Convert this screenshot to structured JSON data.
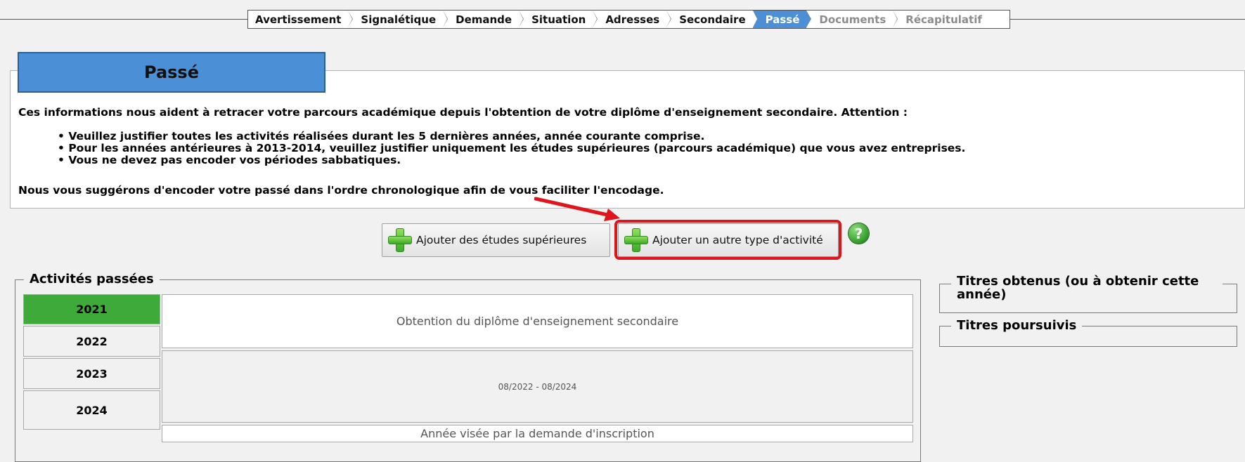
{
  "wizard": {
    "steps": [
      {
        "label": "Avertissement",
        "state": "done"
      },
      {
        "label": "Signalétique",
        "state": "done"
      },
      {
        "label": "Demande",
        "state": "done"
      },
      {
        "label": "Situation",
        "state": "done"
      },
      {
        "label": "Adresses",
        "state": "done"
      },
      {
        "label": "Secondaire",
        "state": "done"
      },
      {
        "label": "Passé",
        "state": "active"
      },
      {
        "label": "Documents",
        "state": "disabled"
      },
      {
        "label": "Récapitulatif",
        "state": "disabled"
      }
    ]
  },
  "section": {
    "title": "Passé",
    "intro": "Ces informations nous aident à retracer votre parcours académique depuis l'obtention de votre diplôme d'enseignement secondaire. Attention :",
    "bullets": [
      "Veuillez justifier toutes les activités réalisées durant les 5 dernières années, année courante comprise.",
      "Pour les années antérieures à 2013-2014, veuillez justifier uniquement les études supérieures (parcours académique) que vous avez entreprises.",
      "Vous ne devez pas encoder vos périodes sabbatiques."
    ],
    "suggestion": "Nous vous suggérons d'encoder votre passé dans l'ordre chronologique afin de vous faciliter l'encodage."
  },
  "actions": {
    "add_studies_label": "Ajouter des études supérieures",
    "add_other_label": "Ajouter un autre type d'activité",
    "help_glyph": "?"
  },
  "activities": {
    "legend": "Activités passées",
    "years": [
      "2021",
      "2022",
      "2023",
      "2024"
    ],
    "diploma_label": "Obtention du diplôme d'enseignement secondaire",
    "period_label": "08/2022 - 08/2024",
    "target_year_label": "Année visée par la demande d'inscription"
  },
  "sidebar": {
    "titles_obtained_legend": "Titres obtenus (ou à obtenir cette année)",
    "titles_pursued_legend": "Titres poursuivis"
  },
  "colors": {
    "accent_blue": "#4b8fd6",
    "current_year_green": "#3daa3a",
    "highlight_red": "#e0141c"
  }
}
